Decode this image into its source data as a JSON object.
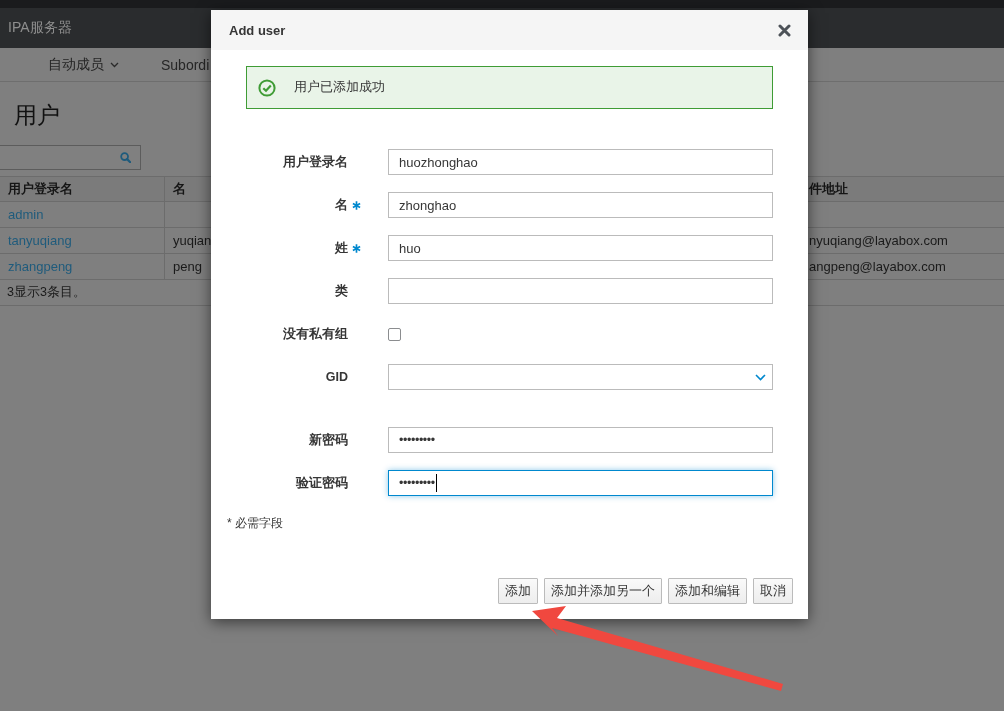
{
  "header": {
    "title": "IPA服务器"
  },
  "nav": {
    "items": [
      {
        "label": "自动成员",
        "dropdown": true
      },
      {
        "label": "Subordi",
        "dropdown": false
      }
    ]
  },
  "page": {
    "heading": "用户"
  },
  "table": {
    "columns": [
      "用户登录名",
      "名",
      "件地址"
    ],
    "rows": [
      {
        "column_1": "admin"
      },
      {
        "column_1": "tanyuqiang",
        "column_2": "yuqian",
        "column_3": "nyuqiang@layabox.com"
      },
      {
        "column_1": "zhangpeng",
        "column_2": "peng",
        "column_3": "angpeng@layabox.com"
      }
    ],
    "summary": "3显示3条目。"
  },
  "dialog": {
    "title": "Add user",
    "alert": {
      "kind": "success",
      "text": "用户已添加成功"
    },
    "fields": [
      {
        "label": "用户登录名",
        "kind": "text",
        "value": "huozhonghao",
        "required": false,
        "focused": false
      },
      {
        "label": "名",
        "kind": "text",
        "value": "zhonghao",
        "required": true,
        "focused": false
      },
      {
        "label": "姓",
        "kind": "text",
        "value": "huo",
        "required": true,
        "focused": false
      },
      {
        "label": "类",
        "kind": "text",
        "required": false,
        "focused": false
      },
      {
        "label": "没有私有组",
        "kind": "checkbox",
        "checked": false,
        "required": false,
        "focused": false
      },
      {
        "label": "GID",
        "kind": "select",
        "required": false,
        "focused": false
      },
      {
        "label": "新密码",
        "kind": "password",
        "value": "•••••••••",
        "required": false,
        "focused": false
      },
      {
        "label": "验证密码",
        "kind": "password",
        "value": "•••••••••",
        "required": false,
        "focused": true
      }
    ],
    "note": "* 必需字段",
    "buttons": [
      "添加",
      "添加并添加另一个",
      "添加和编辑",
      "取消"
    ]
  }
}
